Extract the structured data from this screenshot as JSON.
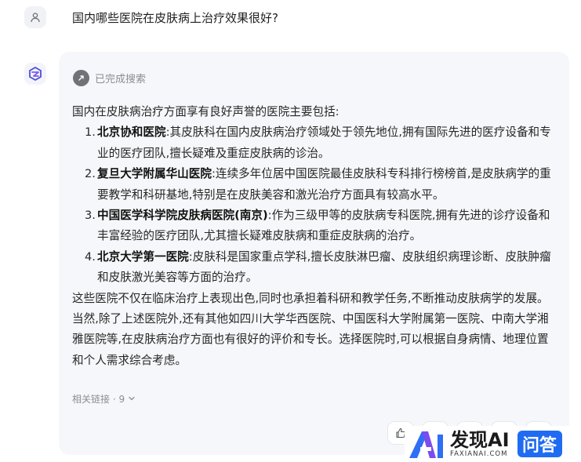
{
  "user": {
    "question": "国内哪些医院在皮肤病上治疗效果很好?"
  },
  "search": {
    "status": "已完成搜索"
  },
  "answer": {
    "intro": "国内在皮肤病治疗方面享有良好声誉的医院主要包括:",
    "items": [
      {
        "num": "1.",
        "name": "北京协和医院",
        "desc": ":其皮肤科在国内皮肤病治疗领域处于领先地位,拥有国际先进的医疗设备和专业的医疗团队,擅长疑难及重症皮肤病的诊治。"
      },
      {
        "num": "2.",
        "name": "复旦大学附属华山医院",
        "desc": ":连续多年位居中国医院最佳皮肤科专科排行榜榜首,是皮肤病学的重要教学和科研基地,特别是在皮肤美容和激光治疗方面具有较高水平。"
      },
      {
        "num": "3.",
        "name": "中国医学科学院皮肤病医院(南京)",
        "desc": ":作为三级甲等的皮肤病专科医院,拥有先进的诊疗设备和丰富经验的医疗团队,尤其擅长疑难皮肤病和重症皮肤病的治疗。"
      },
      {
        "num": "4.",
        "name": "北京大学第一医院",
        "desc": ":皮肤科是国家重点学科,擅长皮肤淋巴瘤、皮肤组织病理诊断、皮肤肿瘤和皮肤激光美容等方面的治疗。"
      }
    ],
    "conclusion": "这些医院不仅在临床治疗上表现出色,同时也承担着科研和教学任务,不断推动皮肤病学的发展。当然,除了上述医院外,还有其他如四川大学华西医院、中国医科大学附属第一医院、中南大学湘雅医院等,在皮肤病治疗方面也有很好的评价和专长。选择医院时,可以根据自身病情、地理位置和个人需求综合考虑。"
  },
  "related": {
    "label": "相关链接 · 9"
  },
  "watermark": {
    "title": "发现AI",
    "subtitle": "FAXIANAI.COM",
    "badge": "问答"
  },
  "icons": {
    "user": "user-icon",
    "bot": "bot-logo-icon",
    "search": "search-done-icon",
    "chevron": "chevron-down-icon",
    "like": "thumbs-up-icon"
  },
  "colors": {
    "card_bg": "#f6f7fa",
    "muted_text": "#8a8d93",
    "brand_blue": "#1f6cf3"
  }
}
